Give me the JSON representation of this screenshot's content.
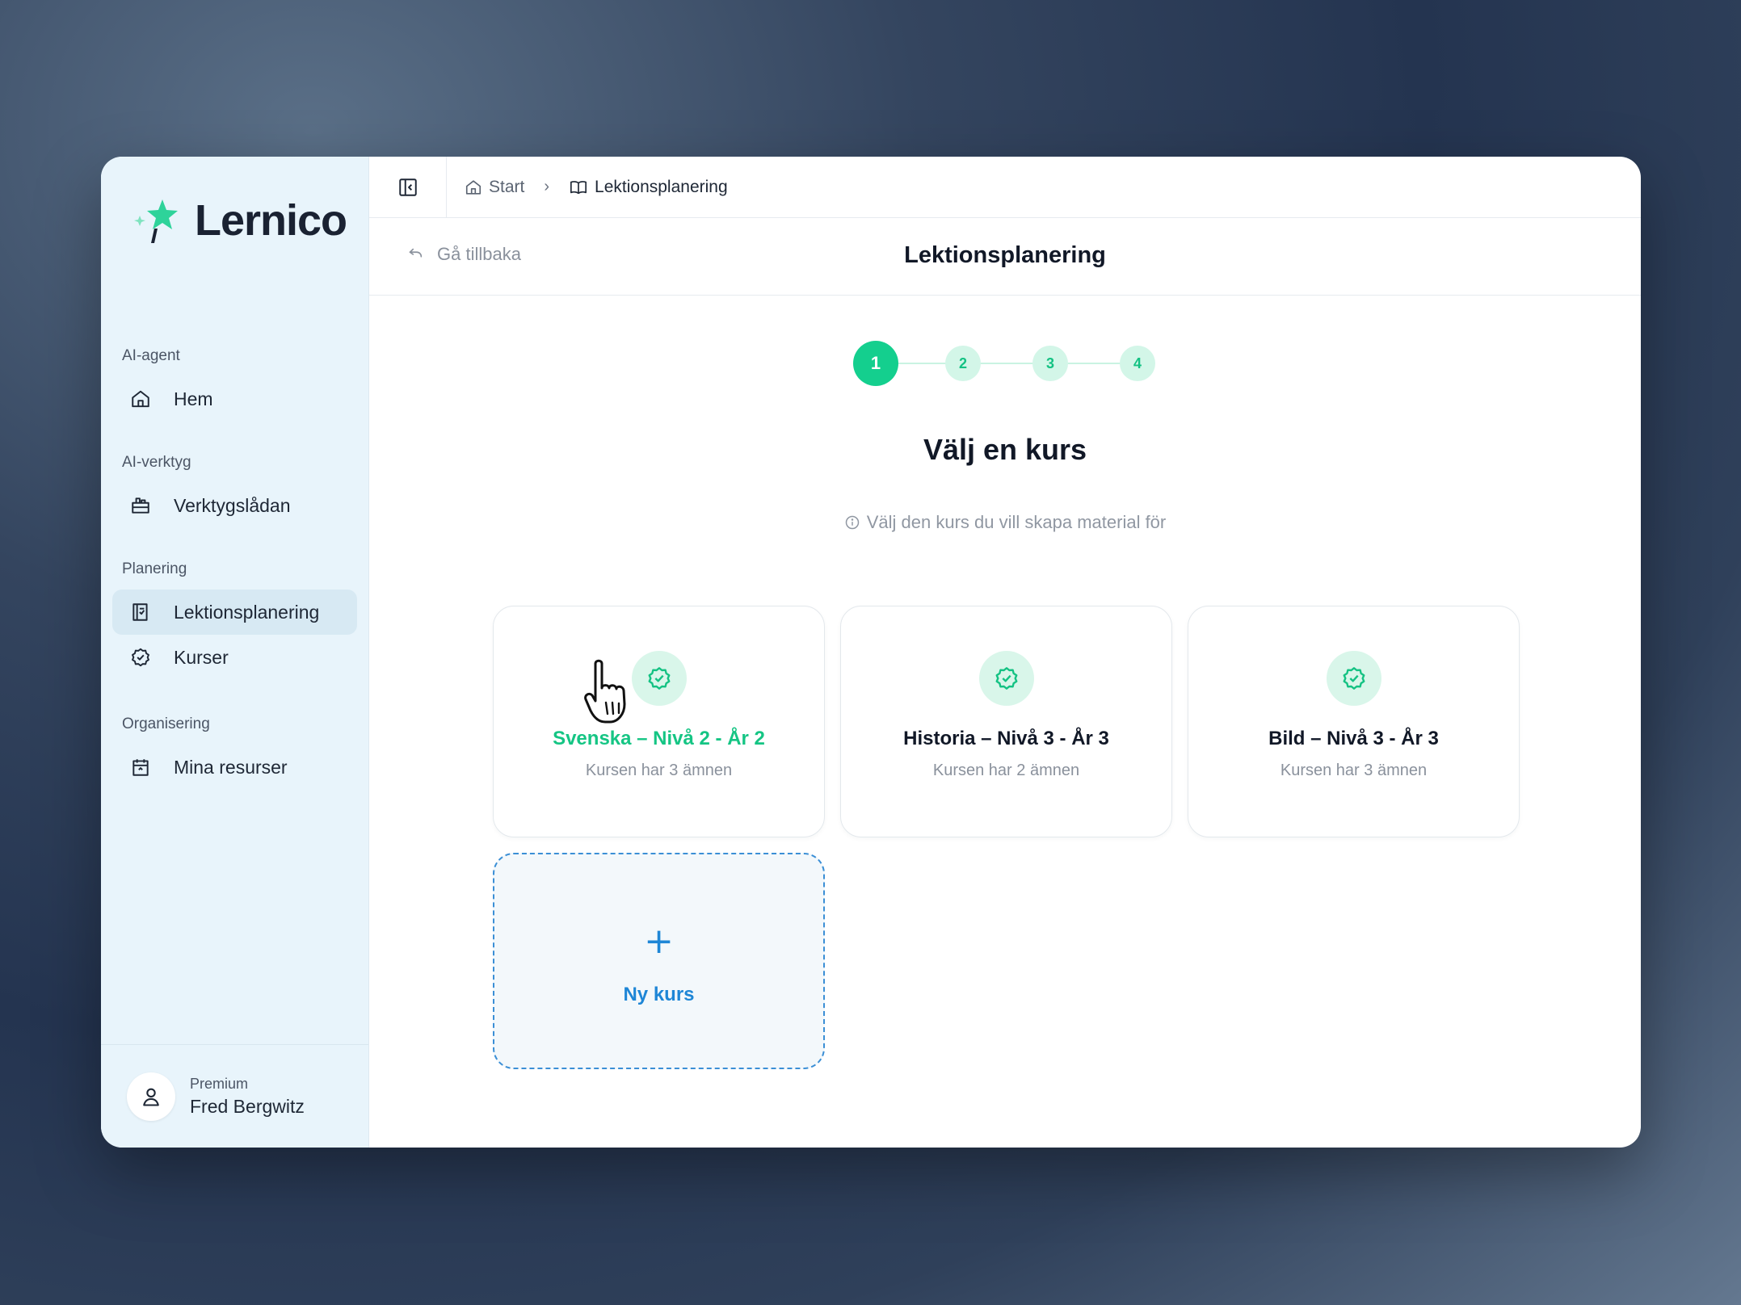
{
  "app": {
    "name": "Lernico",
    "accent_color": "#14cf8e",
    "link_color": "#1e86d6"
  },
  "sidebar": {
    "sections": [
      {
        "label": "AI-agent",
        "items": [
          {
            "label": "Hem",
            "icon": "home-icon"
          }
        ]
      },
      {
        "label": "AI-verktyg",
        "items": [
          {
            "label": "Verktygslådan",
            "icon": "toolbox-icon"
          }
        ]
      },
      {
        "label": "Planering",
        "items": [
          {
            "label": "Lektionsplanering",
            "icon": "lesson-plan-icon",
            "active": true
          },
          {
            "label": "Kurser",
            "icon": "badge-check-icon"
          }
        ]
      },
      {
        "label": "Organisering",
        "items": [
          {
            "label": "Mina resurser",
            "icon": "calendar-icon"
          }
        ]
      }
    ],
    "user": {
      "plan": "Premium",
      "name": "Fred Bergwitz"
    }
  },
  "topbar": {
    "breadcrumb": [
      {
        "label": "Start",
        "icon": "home-icon"
      },
      {
        "label": "Lektionsplanering",
        "icon": "book-open-icon"
      }
    ]
  },
  "subheader": {
    "back_label": "Gå tillbaka",
    "title": "Lektionsplanering"
  },
  "stepper": {
    "steps": [
      "1",
      "2",
      "3",
      "4"
    ],
    "current": 1
  },
  "content": {
    "heading": "Välj en kurs",
    "hint": "Välj den kurs du vill skapa material för",
    "courses": [
      {
        "name": "Svenska – Nivå 2 - År 2",
        "subtitle": "Kursen har 3 ämnen",
        "highlighted": true
      },
      {
        "name": "Historia – Nivå 3 - År 3",
        "subtitle": "Kursen har 2 ämnen",
        "highlighted": false
      },
      {
        "name": "Bild – Nivå 3 - År 3",
        "subtitle": "Kursen har 3 ämnen",
        "highlighted": false
      }
    ],
    "new_course": {
      "label": "Ny kurs",
      "icon": "plus-icon"
    }
  }
}
